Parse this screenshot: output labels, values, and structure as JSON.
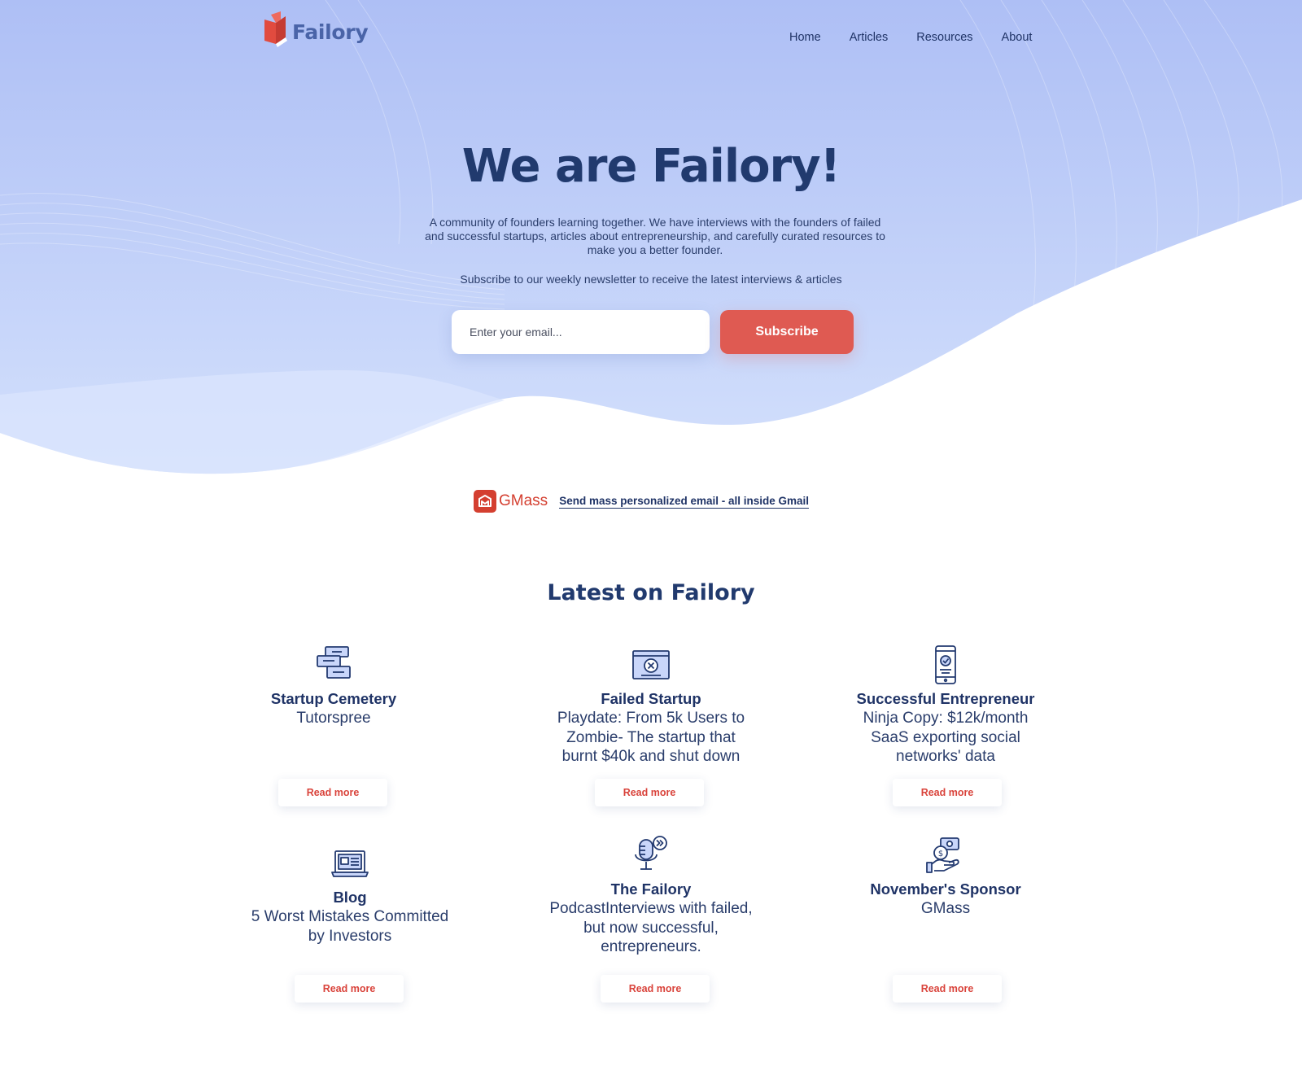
{
  "brand": {
    "name": "Failory",
    "accent": "#df5a52",
    "navy": "#1f3366"
  },
  "nav": {
    "items": [
      "Home",
      "Articles",
      "Resources",
      "About"
    ]
  },
  "hero": {
    "title": "We are Failory!",
    "description": "A community of founders learning together. We have interviews with the founders of failed and successful startups, articles about entrepreneurship, and carefully curated resources to make you a better founder.",
    "subscribe_text": "Subscribe to our weekly newsletter to receive the latest interviews & articles",
    "email_placeholder": "Enter your email...",
    "subscribe_label": "Subscribe"
  },
  "sponsor": {
    "name": "GMass",
    "link_text": "Send mass personalized email - all inside Gmail"
  },
  "latest": {
    "title": "Latest on Failory",
    "cards": [
      {
        "icon": "boxes-icon",
        "title": "Startup Cemetery",
        "subtitle": "Tutorspree",
        "button": "Read more"
      },
      {
        "icon": "monitor-x-icon",
        "title": "Failed Startup",
        "subtitle": "Playdate: From 5k Users to Zombie- The startup that burnt $40k and shut down",
        "button": "Read more"
      },
      {
        "icon": "phone-check-icon",
        "title": "Successful Entrepreneur",
        "subtitle": "Ninja Copy: $12k/month SaaS exporting social networks' data",
        "button": "Read more"
      },
      {
        "icon": "laptop-icon",
        "title": "Blog",
        "subtitle": "5 Worst Mistakes Committed by Investors",
        "button": "Read more"
      },
      {
        "icon": "microphone-icon",
        "title": "The Failory",
        "subtitle": "PodcastInterviews with failed, but now successful, entrepreneurs.",
        "button": "Read more"
      },
      {
        "icon": "money-hand-icon",
        "title": "November's Sponsor",
        "subtitle": "GMass",
        "button": "Read more"
      }
    ]
  }
}
